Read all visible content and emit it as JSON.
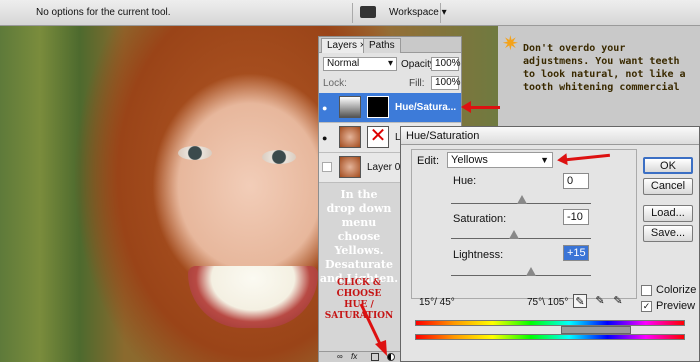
{
  "options_bar": {
    "hint": "No options for the current tool.",
    "workspace_label": "Workspace"
  },
  "annotations": {
    "tip": [
      "Don't overdo your",
      "adjustmens. You want teeth",
      "to look natural, not like a",
      "tooth whitening commercial"
    ],
    "instruction": [
      "In the",
      "drop down menu",
      "choose Yellows.",
      "Desaturate",
      "and Lighten."
    ],
    "click_note": [
      "CLICK & CHOOSE",
      "HUE / SATURATION"
    ]
  },
  "layers_panel": {
    "tabs": [
      "Layers",
      "Paths"
    ],
    "tab_close": "×",
    "blend_mode": "Normal",
    "opacity_label": "Opacity:",
    "opacity_value": "100%",
    "lock_label": "Lock:",
    "fill_label": "Fill:",
    "fill_value": "100%",
    "layers": [
      {
        "name": "Hue/Satura...",
        "selected": true
      },
      {
        "name": "La",
        "selected": false
      },
      {
        "name": "Layer 0",
        "selected": false
      }
    ],
    "footer_icons": [
      "link-layers-icon",
      "fx-icon",
      "mask-icon",
      "adjustment-layer-icon"
    ]
  },
  "dialog": {
    "title": "Hue/Saturation",
    "edit_label": "Edit:",
    "edit_value": "Yellows",
    "hue_label": "Hue:",
    "hue_value": "0",
    "saturation_label": "Saturation:",
    "saturation_value": "-10",
    "lightness_label": "Lightness:",
    "lightness_value": "+15",
    "range_left": "15°/ 45°",
    "range_right": "75°\\ 105°",
    "buttons": {
      "ok": "OK",
      "cancel": "Cancel",
      "load": "Load...",
      "save": "Save..."
    },
    "colorize_label": "Colorize",
    "colorize_checked": false,
    "preview_label": "Preview",
    "preview_checked": true,
    "hue_level": 0.5,
    "saturation_level": 0.45,
    "lightness_level": 0.57
  },
  "colors": {
    "accent_red": "#d11111",
    "selection_blue": "#3d7bd9"
  }
}
